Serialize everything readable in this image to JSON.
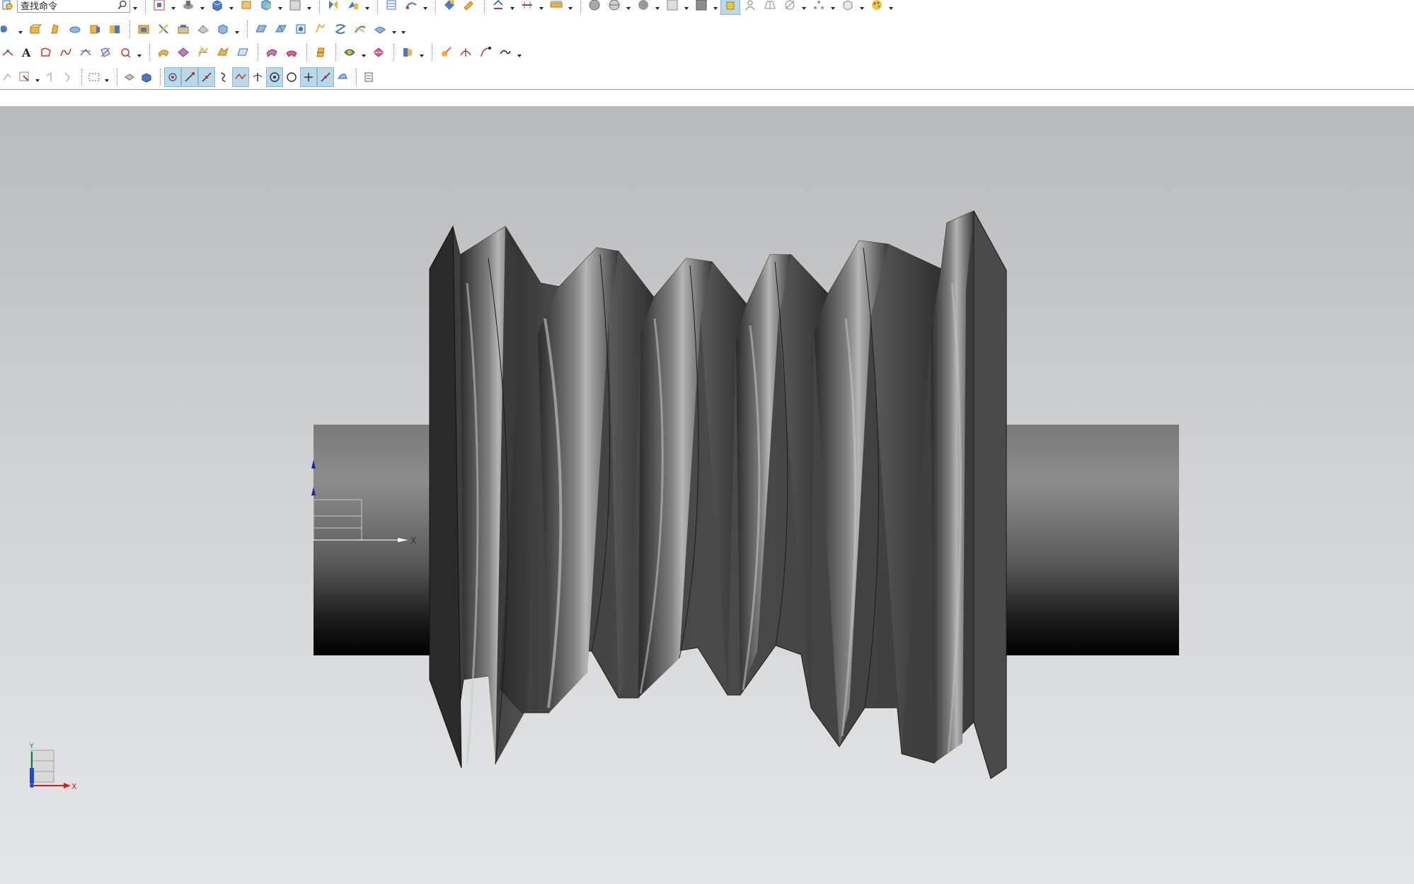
{
  "toolbar": {
    "search_value": "查找命令",
    "row1_icons": [
      "command-finder-icon",
      "fit-view-icon",
      "shaded-view-icon",
      "orient-view-icon",
      "display-part-icon",
      "layer-icon",
      "box-icon",
      "snap-view-icon",
      "show-hide-icon",
      "section-icon",
      "analysis-icon",
      "pattern-icon",
      "measure-icon",
      "distance-icon",
      "sphere-shade-icon",
      "sphere-edge-icon",
      "sphere-icon",
      "background-icon",
      "color-icon",
      "lighting-icon",
      "wireframe-icon",
      "grid-icon",
      "perspective-icon",
      "network-icon",
      "cube-icon",
      "palette-icon"
    ],
    "row2_icons": [
      "sketch-icon",
      "extrude-icon",
      "revolve-icon",
      "sweep-icon",
      "block-icon",
      "cylinder-icon",
      "cone-icon",
      "sphere-solid-icon",
      "union-icon",
      "subtract-icon",
      "intersect-icon",
      "edge-blend-icon",
      "chamfer-icon",
      "shell-icon",
      "draft-icon",
      "thread-icon",
      "trim-icon",
      "split-icon",
      "mirror-icon"
    ],
    "row3_icons": [
      "point-icon",
      "text-icon",
      "curve-icon",
      "spline-icon",
      "helix-icon",
      "project-icon",
      "offset-curve-icon",
      "through-curves-icon",
      "ruled-icon",
      "sew-icon",
      "patch-icon",
      "bounded-plane-icon",
      "n-sided-icon",
      "law-extension-icon",
      "studio-surface-icon",
      "surface-analysis-icon",
      "view-section-icon",
      "curvature-icon",
      "deviation-icon",
      "reflection-icon",
      "smoothness-icon"
    ],
    "row4_icons": [
      "undo-select-icon",
      "select-filter-icon",
      "selection-scope-icon",
      "box-select-icon",
      "body-select-icon",
      "face-select-icon",
      "snap-point-icon",
      "end-point-icon",
      "mid-point-icon",
      "control-point-icon",
      "intersection-point-icon",
      "tangent-icon",
      "center-point-icon",
      "quadrant-icon",
      "existing-point-icon",
      "point-on-curve-icon",
      "point-on-face-icon",
      "pole-icon"
    ]
  },
  "viewport": {
    "wcs_x_label": "X",
    "triad_x_label": "X",
    "triad_y_label": "Y"
  }
}
